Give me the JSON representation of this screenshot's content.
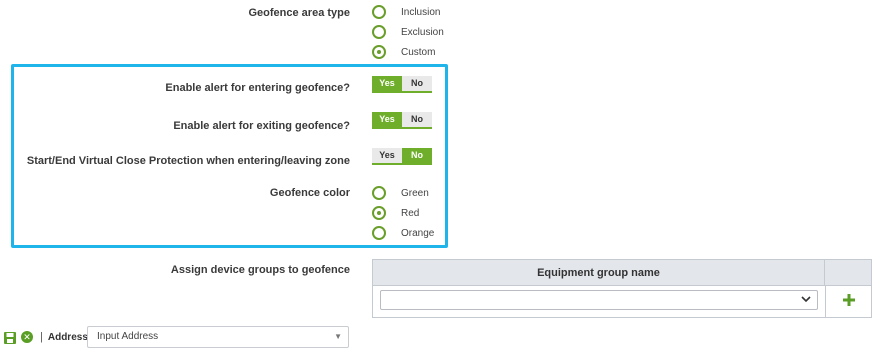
{
  "geofence_area_type": {
    "label": "Geofence area type",
    "options": [
      {
        "label": "Inclusion",
        "checked": false
      },
      {
        "label": "Exclusion",
        "checked": false
      },
      {
        "label": "Custom",
        "checked": true
      }
    ]
  },
  "alert_entering": {
    "label": "Enable alert for entering geofence?",
    "yes": "Yes",
    "no": "No",
    "value": "Yes"
  },
  "alert_exiting": {
    "label": "Enable alert for exiting geofence?",
    "yes": "Yes",
    "no": "No",
    "value": "Yes"
  },
  "virtual_close": {
    "label": "Start/End Virtual Close Protection when entering/leaving zone",
    "yes": "Yes",
    "no": "No",
    "value": "No"
  },
  "geofence_color": {
    "label": "Geofence color",
    "options": [
      {
        "label": "Green",
        "checked": false
      },
      {
        "label": "Red",
        "checked": true
      },
      {
        "label": "Orange",
        "checked": false
      }
    ]
  },
  "device_groups": {
    "label": "Assign device groups to geofence",
    "column_header": "Equipment group name",
    "selected_value": ""
  },
  "address": {
    "label": "Address",
    "separator": "|",
    "placeholder": "Input Address"
  },
  "colors": {
    "accent_green": "#6fae2a",
    "highlight_border": "#1fb5ea",
    "table_header_bg": "#e3e6eb"
  },
  "icons": {
    "save": "save-icon",
    "cancel": "cancel-icon",
    "add": "plus-icon",
    "dropdown": "chevron-down-icon"
  }
}
